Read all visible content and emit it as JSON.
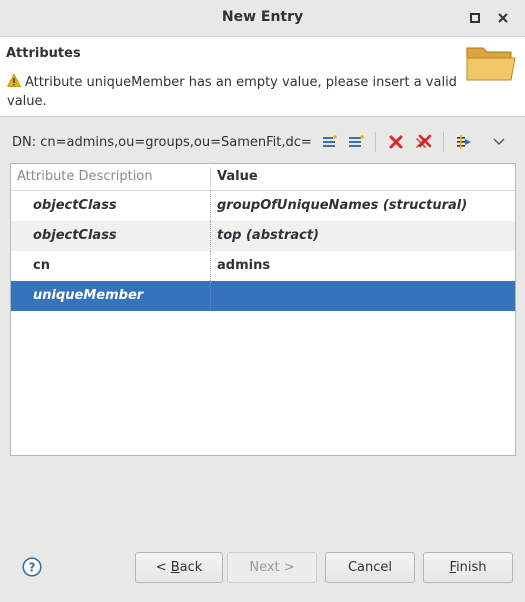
{
  "window": {
    "title": "New Entry"
  },
  "banner": {
    "title": "Attributes",
    "message": "Attribute uniqueMember has an empty value, please insert a valid value."
  },
  "dn": {
    "label": "DN: cn=admins,ou=groups,ou=SamenFit,dc=s"
  },
  "toolbar": {
    "icons": [
      "new-attribute-icon",
      "new-value-icon",
      "delete-icon",
      "delete-all-icon",
      "filter-icon",
      "menu-chevron-icon"
    ]
  },
  "table": {
    "headers": {
      "description": "Attribute Description",
      "value": "Value"
    },
    "rows": [
      {
        "description": "objectClass",
        "value": "groupOfUniqueNames (structural)"
      },
      {
        "description": "objectClass",
        "value": "top (abstract)"
      },
      {
        "description": "cn",
        "value": "admins"
      },
      {
        "description": "uniqueMember",
        "value": ""
      }
    ]
  },
  "buttons": {
    "back": {
      "prefix": "< ",
      "mnemonic": "B",
      "rest": "ack"
    },
    "next": "Next >",
    "cancel": "Cancel",
    "finish": {
      "mnemonic": "F",
      "rest": "inish"
    }
  },
  "colors": {
    "selection": "#3574bc",
    "delete": "#e0262a",
    "toolbar_blue": "#3b6fb4",
    "folder": "#f0c060",
    "warning": "#e7b416"
  }
}
